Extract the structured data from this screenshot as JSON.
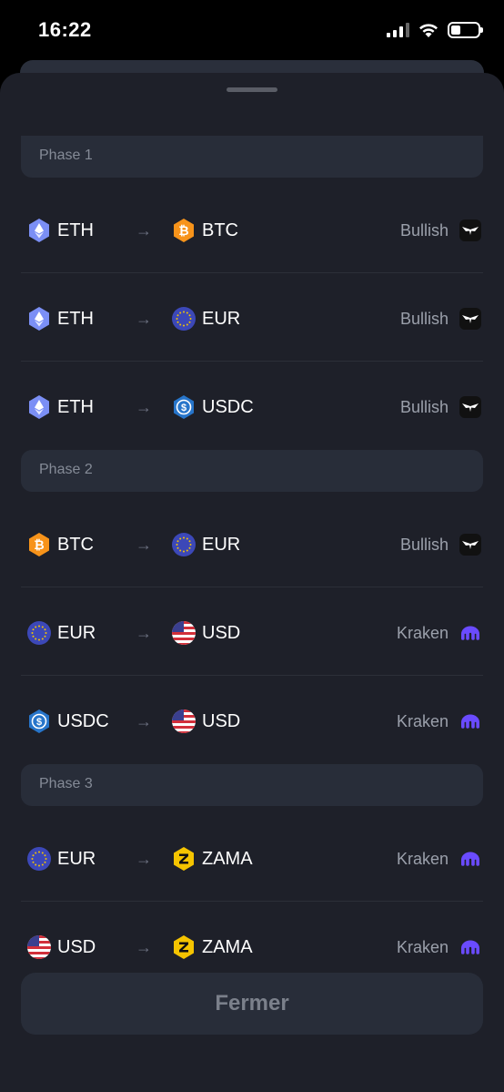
{
  "status_bar": {
    "time": "16:22"
  },
  "phases": [
    {
      "label": "Phase 1",
      "routes": [
        {
          "from": {
            "symbol": "ETH",
            "icon": "eth-icon"
          },
          "to": {
            "symbol": "BTC",
            "icon": "btc-icon"
          },
          "exchange": "Bullish",
          "exchange_icon": "bullish-logo-icon"
        },
        {
          "from": {
            "symbol": "ETH",
            "icon": "eth-icon"
          },
          "to": {
            "symbol": "EUR",
            "icon": "eur-icon"
          },
          "exchange": "Bullish",
          "exchange_icon": "bullish-logo-icon"
        },
        {
          "from": {
            "symbol": "ETH",
            "icon": "eth-icon"
          },
          "to": {
            "symbol": "USDC",
            "icon": "usdc-icon"
          },
          "exchange": "Bullish",
          "exchange_icon": "bullish-logo-icon"
        }
      ]
    },
    {
      "label": "Phase 2",
      "routes": [
        {
          "from": {
            "symbol": "BTC",
            "icon": "btc-icon"
          },
          "to": {
            "symbol": "EUR",
            "icon": "eur-icon"
          },
          "exchange": "Bullish",
          "exchange_icon": "bullish-logo-icon"
        },
        {
          "from": {
            "symbol": "EUR",
            "icon": "eur-icon"
          },
          "to": {
            "symbol": "USD",
            "icon": "usd-flag-icon"
          },
          "exchange": "Kraken",
          "exchange_icon": "kraken-logo-icon"
        },
        {
          "from": {
            "symbol": "USDC",
            "icon": "usdc-icon"
          },
          "to": {
            "symbol": "USD",
            "icon": "usd-flag-icon"
          },
          "exchange": "Kraken",
          "exchange_icon": "kraken-logo-icon"
        }
      ]
    },
    {
      "label": "Phase 3",
      "routes": [
        {
          "from": {
            "symbol": "EUR",
            "icon": "eur-icon"
          },
          "to": {
            "symbol": "ZAMA",
            "icon": "zama-icon"
          },
          "exchange": "Kraken",
          "exchange_icon": "kraken-logo-icon"
        },
        {
          "from": {
            "symbol": "USD",
            "icon": "usd-flag-icon"
          },
          "to": {
            "symbol": "ZAMA",
            "icon": "zama-icon"
          },
          "exchange": "Kraken",
          "exchange_icon": "kraken-logo-icon"
        }
      ]
    }
  ],
  "close_label": "Fermer",
  "colors": {
    "sheet_bg": "#1e2029",
    "phase_bg": "#282d39",
    "eth": "#7b8ff5",
    "btc": "#f7931a",
    "eur": "#3c48b8",
    "usdc": "#2775ca",
    "zama": "#f5c400",
    "kraken": "#6a4bff"
  }
}
